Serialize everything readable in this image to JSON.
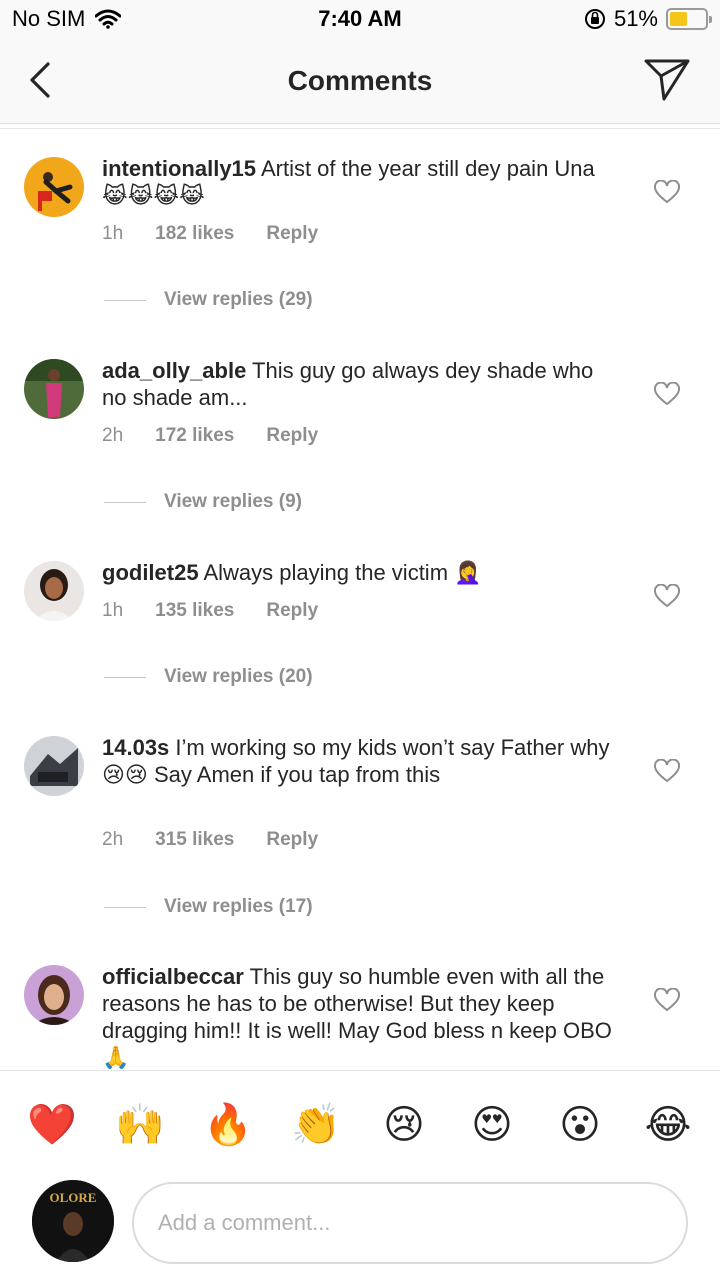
{
  "status_bar": {
    "carrier": "No SIM",
    "time": "7:40 AM",
    "battery": "51%",
    "battery_level": 0.51
  },
  "header": {
    "title": "Comments",
    "back_icon": "chevron-left-icon",
    "send_icon": "send-icon"
  },
  "comments": [
    {
      "username": "intentionally15",
      "text": "Artist of the year still dey pain Una 😹😹😹😹",
      "time": "1h",
      "likes": "182 likes",
      "reply": "Reply",
      "view_replies": "View replies (29)"
    },
    {
      "username": "ada_olly_able",
      "text": "This guy go always dey shade who no shade am...",
      "time": "2h",
      "likes": "172 likes",
      "reply": "Reply",
      "view_replies": "View replies (9)"
    },
    {
      "username": "godilet25",
      "text": "Always playing the victim 🤦‍♀️",
      "time": "1h",
      "likes": "135 likes",
      "reply": "Reply",
      "view_replies": "View replies (20)"
    },
    {
      "username": "14.03s",
      "text": "I’m working so my kids won’t say Father why 😢😢 Say Amen if you tap from this",
      "time": "2h",
      "likes": "315 likes",
      "reply": "Reply",
      "view_replies": "View replies (17)"
    },
    {
      "username": "officialbeccar",
      "text": "This guy so humble even with all the reasons he has to be otherwise! But they keep dragging him!! It is well! May God bless n keep OBO🙏"
    }
  ],
  "reactions": [
    "❤️",
    "🙌",
    "🔥",
    "👏",
    "😢",
    "😍",
    "😮",
    "😂"
  ],
  "composer": {
    "placeholder": "Add a comment...",
    "avatar_text": "OLORE"
  },
  "colors": {
    "text": "#262626",
    "secondary": "#8e8e8e",
    "battery": "#f5c518"
  }
}
